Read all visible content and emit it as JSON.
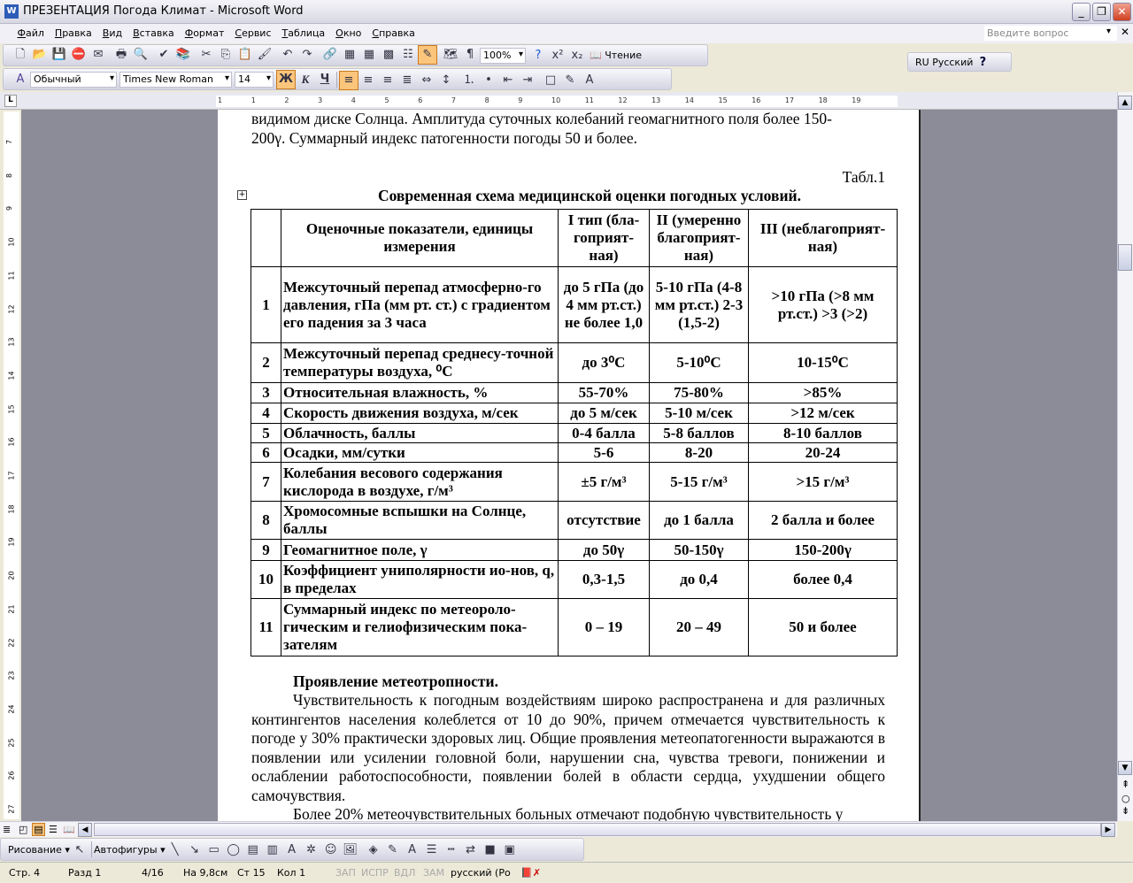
{
  "window": {
    "title": "ПРЕЗЕНТАЦИЯ Погода Климат - Microsoft Word",
    "app_icon": "W"
  },
  "menu": [
    "Файл",
    "Правка",
    "Вид",
    "Вставка",
    "Формат",
    "Сервис",
    "Таблица",
    "Окно",
    "Справка"
  ],
  "help_box": {
    "placeholder": "Введите вопрос"
  },
  "standard_toolbar": {
    "icons": [
      "new-icon",
      "open-icon",
      "save-icon",
      "permission-icon",
      "email-icon",
      "|",
      "print-icon",
      "print-preview-icon",
      "|",
      "spelling-icon",
      "research-icon",
      "|",
      "cut-icon",
      "copy-icon",
      "paste-icon",
      "format-painter-icon",
      "|",
      "undo-icon",
      "redo-icon",
      "|",
      "hyperlink-icon",
      "tables-borders-icon",
      "insert-table-icon",
      "insert-excel-icon",
      "columns-icon",
      "drawing-icon",
      "|",
      "document-map-icon",
      "show-formatting-icon"
    ],
    "zoom": "100%",
    "reading_label": "Чтение"
  },
  "format_toolbar": {
    "style": "Обычный",
    "font": "Times New Roman",
    "size": "14",
    "bold": "Ж",
    "italic": "К",
    "underline": "Ч"
  },
  "language_bar": {
    "label": "RU Русский"
  },
  "ruler": {
    "h_ticks": [
      "1",
      "1",
      "2",
      "3",
      "4",
      "5",
      "6",
      "7",
      "8",
      "9",
      "10",
      "11",
      "12",
      "13",
      "14",
      "15",
      "16",
      "17",
      "18",
      "19"
    ],
    "v_ticks": [
      "7",
      "8",
      "9",
      "10",
      "11",
      "12",
      "13",
      "14",
      "15",
      "16",
      "17",
      "18",
      "19",
      "20",
      "21",
      "22",
      "23",
      "24",
      "25",
      "26",
      "27"
    ]
  },
  "document": {
    "para_top_1": "видимом диске Солнца. Амплитуда суточных колебаний геомагнитного поля более 150-",
    "para_top_2": "200γ. Суммарный индекс патогенности погоды 50 и более.",
    "table_ref": "Табл.1",
    "table_title": "Современная схема медицинской оценки погодных условий.",
    "table": {
      "header": [
        "",
        "Оценочные показатели, единицы измерения",
        "I тип (бла-гоприят-ная)",
        "II (умеренно благоприят-ная)",
        "III (неблагоприят-ная)"
      ],
      "rows": [
        [
          "1",
          "Межсуточный перепад атмосферно-го давления, гПа (мм рт. ст.) с градиентом его падения за 3 часа",
          "до 5 гПа (до 4 мм рт.ст.) не более 1,0",
          "5-10 гПа (4-8 мм рт.ст.) 2-3 (1,5-2)",
          ">10 гПа (>8 мм рт.ст.) >3 (>2)"
        ],
        [
          "2",
          "Межсуточный перепад среднесу-точной температуры воздуха, ⁰С",
          "до 3⁰С",
          "5-10⁰С",
          "10-15⁰С"
        ],
        [
          "3",
          "Относительная влажность, %",
          "55-70%",
          "75-80%",
          ">85%"
        ],
        [
          "4",
          "Скорость движения воздуха, м/сек",
          "до 5 м/сек",
          "5-10 м/сек",
          ">12 м/сек"
        ],
        [
          "5",
          "Облачность, баллы",
          "0-4 балла",
          "5-8 баллов",
          "8-10 баллов"
        ],
        [
          "6",
          "Осадки, мм/сутки",
          "5-6",
          "8-20",
          "20-24"
        ],
        [
          "7",
          "Колебания весового содержания кислорода в воздухе, г/м³",
          "±5 г/м³",
          "5-15 г/м³",
          ">15 г/м³"
        ],
        [
          "8",
          "Хромосомные вспышки на Солнце, баллы",
          "отсутствие",
          "до 1 балла",
          "2 балла и более"
        ],
        [
          "9",
          "Геомагнитное поле, γ",
          "до 50γ",
          "50-150γ",
          "150-200γ"
        ],
        [
          "10",
          "Коэффициент униполярности ио-нов, q, в пределах",
          "0,3-1,5",
          "до 0,4",
          "более 0,4"
        ],
        [
          "11",
          "Суммарный индекс по метеороло-гическим и гелиофизическим пока-зателям",
          "0 – 19",
          "20 – 49",
          "50 и более"
        ]
      ]
    },
    "heading": "Проявление метеотропности.",
    "para_1": "Чувствительность к погодным воздействиям широко распространена и для различных контингентов населения колеблется от 10 до 90%, причем отмечается чувствительность к погоде у 30% практически здоровых лиц. Общие проявления метеопатогенности выражаются в появлении или усилении головной боли, нарушении сна, чувства тревоги, понижении и ослаблении работоспособности, появлении болей в области сердца, ухудшении общего самочувствия.",
    "para_2": "Более 20% метеочувствительных больных отмечают подобную чувствительность у"
  },
  "drawing_toolbar": {
    "drawing": "Рисование",
    "autoshapes": "Автофигуры"
  },
  "status": {
    "page": "Стр. 4",
    "section": "Разд 1",
    "pages": "4/16",
    "at": "На 9,8см",
    "line": "Ст 15",
    "col": "Кол 1",
    "rec": "ЗАП",
    "trk": "ИСПР",
    "ext": "ВДЛ",
    "ovr": "ЗАМ",
    "lang": "русский (Ро"
  }
}
